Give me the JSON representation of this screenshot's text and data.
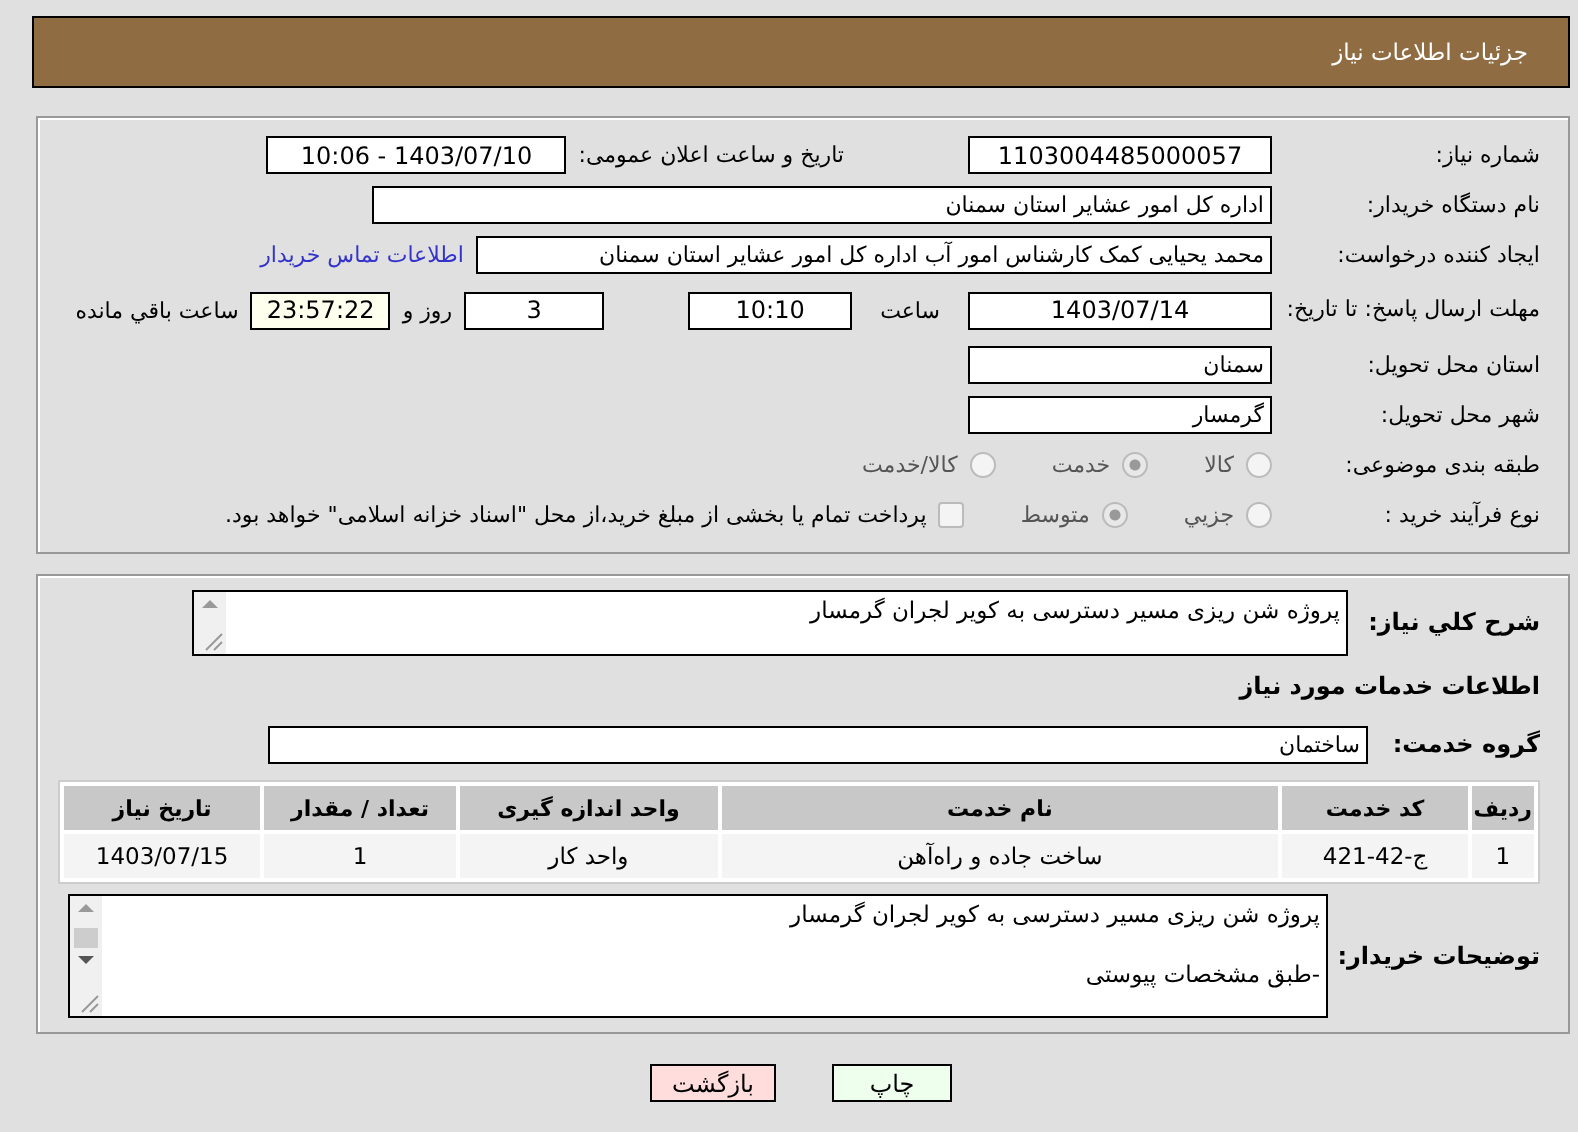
{
  "header": {
    "title": "جزئیات اطلاعات نیاز"
  },
  "details": {
    "need_number": {
      "label": "شماره نیاز:",
      "value": "1103004485000057"
    },
    "announce": {
      "label": "تاریخ و ساعت اعلان عمومی:",
      "value": "1403/07/10 - 10:06"
    },
    "buyer": {
      "label": "نام دستگاه خریدار:",
      "value": "اداره کل امور عشایر استان سمنان"
    },
    "creator": {
      "label": "ایجاد کننده درخواست:",
      "value": "محمد یحیایی کمک کارشناس امور آب اداره کل امور عشایر استان سمنان",
      "link": "اطلاعات تماس خریدار"
    },
    "deadline": {
      "label": "مهلت ارسال پاسخ: تا تاریخ:",
      "date": "1403/07/14",
      "time_label": "ساعت",
      "time": "10:10",
      "days": "3",
      "days_label": "روز و",
      "remaining": "23:57:22",
      "remaining_label": "ساعت باقي مانده"
    },
    "province": {
      "label": "استان محل تحویل:",
      "value": "سمنان"
    },
    "city": {
      "label": "شهر محل تحویل:",
      "value": "گرمسار"
    },
    "category": {
      "label": "طبقه بندی موضوعی:",
      "options": [
        {
          "label": "کالا",
          "selected": false
        },
        {
          "label": "خدمت",
          "selected": true
        },
        {
          "label": "کالا/خدمت",
          "selected": false
        }
      ]
    },
    "process": {
      "label": "نوع فرآیند خرید :",
      "options": [
        {
          "label": "جزیي",
          "selected": false
        },
        {
          "label": "متوسط",
          "selected": true
        }
      ],
      "payment": {
        "checked": false,
        "text": "پرداخت تمام یا بخشی از مبلغ خرید،از محل \"اسناد خزانه اسلامی\" خواهد بود."
      }
    }
  },
  "services": {
    "summary": {
      "label": "شرح کلي نياز:",
      "value": "پروژه شن ریزی مسیر دسترسی به کویر لجران گرمسار"
    },
    "heading": "اطلاعات خدمات مورد نیاز",
    "group": {
      "label": "گروه خدمت:",
      "value": "ساختمان"
    },
    "table": {
      "columns": [
        "ردیف",
        "کد خدمت",
        "نام خدمت",
        "واحد اندازه گیری",
        "تعداد / مقدار",
        "تاریخ نیاز"
      ],
      "rows": [
        [
          "1",
          "ج-42-421",
          "ساخت جاده و راه‌آهن",
          "واحد کار",
          "1",
          "1403/07/15"
        ]
      ]
    },
    "notes": {
      "label": "توضیحات خریدار:",
      "paragraphs": [
        "پروژه شن ریزی مسیر دسترسی به کویر لجران گرمسار",
        "-طبق مشخصات پیوستی"
      ]
    }
  },
  "buttons": [
    {
      "label": "چاپ",
      "kind": "print"
    },
    {
      "label": "بازگشت",
      "kind": "back"
    }
  ]
}
